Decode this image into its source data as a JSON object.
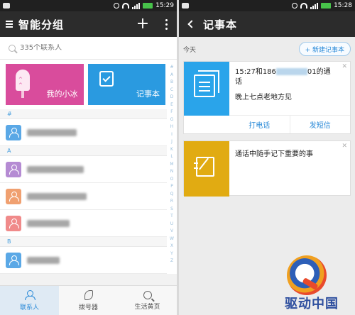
{
  "left": {
    "status": {
      "time": "15:29"
    },
    "title": "智能分组",
    "search_placeholder": "335个联系人",
    "tiles": [
      {
        "label": "我的小冰",
        "color": "#d94c9c"
      },
      {
        "label": "记事本",
        "color": "#2a9ae0"
      }
    ],
    "sections": [
      "#",
      "A",
      "B"
    ],
    "avatar_colors": [
      "#5aa8e6",
      "#b58bd3",
      "#f0a070",
      "#f08a8a",
      "#5aa8e6"
    ],
    "index_letters": [
      "#",
      "A",
      "B",
      "C",
      "D",
      "E",
      "F",
      "G",
      "H",
      "I",
      "J",
      "K",
      "L",
      "M",
      "N",
      "O",
      "P",
      "Q",
      "R",
      "S",
      "T",
      "U",
      "V",
      "W",
      "X",
      "Y",
      "Z"
    ],
    "tabs": [
      {
        "label": "联系人",
        "icon": "contacts-icon",
        "active": true
      },
      {
        "label": "拨号器",
        "icon": "phone-icon",
        "active": false
      },
      {
        "label": "生活黄页",
        "icon": "yellow-pages-icon",
        "active": false
      }
    ]
  },
  "right": {
    "status": {
      "time": "15:28"
    },
    "title": "记事本",
    "today_label": "今天",
    "new_note_label": "+ 新建记事本",
    "card1": {
      "time_prefix": "15:27和186",
      "number_suffix": "01的通",
      "line1_cont": "话",
      "line2": "晚上七点老地方见",
      "action_call": "打电话",
      "action_sms": "发短信"
    },
    "card2": {
      "text": "通话中随手记下重要的事"
    }
  },
  "watermark": {
    "text": "驱动中国"
  }
}
